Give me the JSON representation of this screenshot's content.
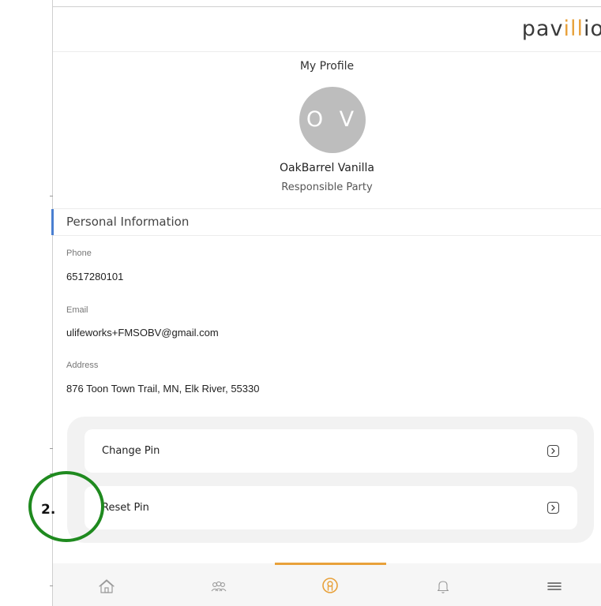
{
  "app": {
    "brand_main": "pav",
    "brand_accent": "ill",
    "brand_tail": "io",
    "brand_accent_color": "#e8a13a"
  },
  "page": {
    "title": "My Profile"
  },
  "profile": {
    "initials": "O V",
    "name": "OakBarrel Vanilla",
    "role": "Responsible Party"
  },
  "personal_info": {
    "section_title": "Personal Information",
    "phone_label": "Phone",
    "phone_value": "6517280101",
    "email_label": "Email",
    "email_value": "ulifeworks+FMSOBV@gmail.com",
    "address_label": "Address",
    "address_value": "876 Toon Town Trail, MN, Elk River, 55330"
  },
  "actions": {
    "change_pin": "Change Pin",
    "reset_pin": "Reset Pin"
  },
  "annotation": {
    "label": "2.",
    "color": "#1f8a1f"
  },
  "bottom_nav": {
    "items": [
      {
        "icon": "home-icon"
      },
      {
        "icon": "people-icon"
      },
      {
        "icon": "profile-icon",
        "active": true
      },
      {
        "icon": "bell-icon"
      },
      {
        "icon": "menu-icon"
      }
    ],
    "active_color": "#e8a13a"
  }
}
